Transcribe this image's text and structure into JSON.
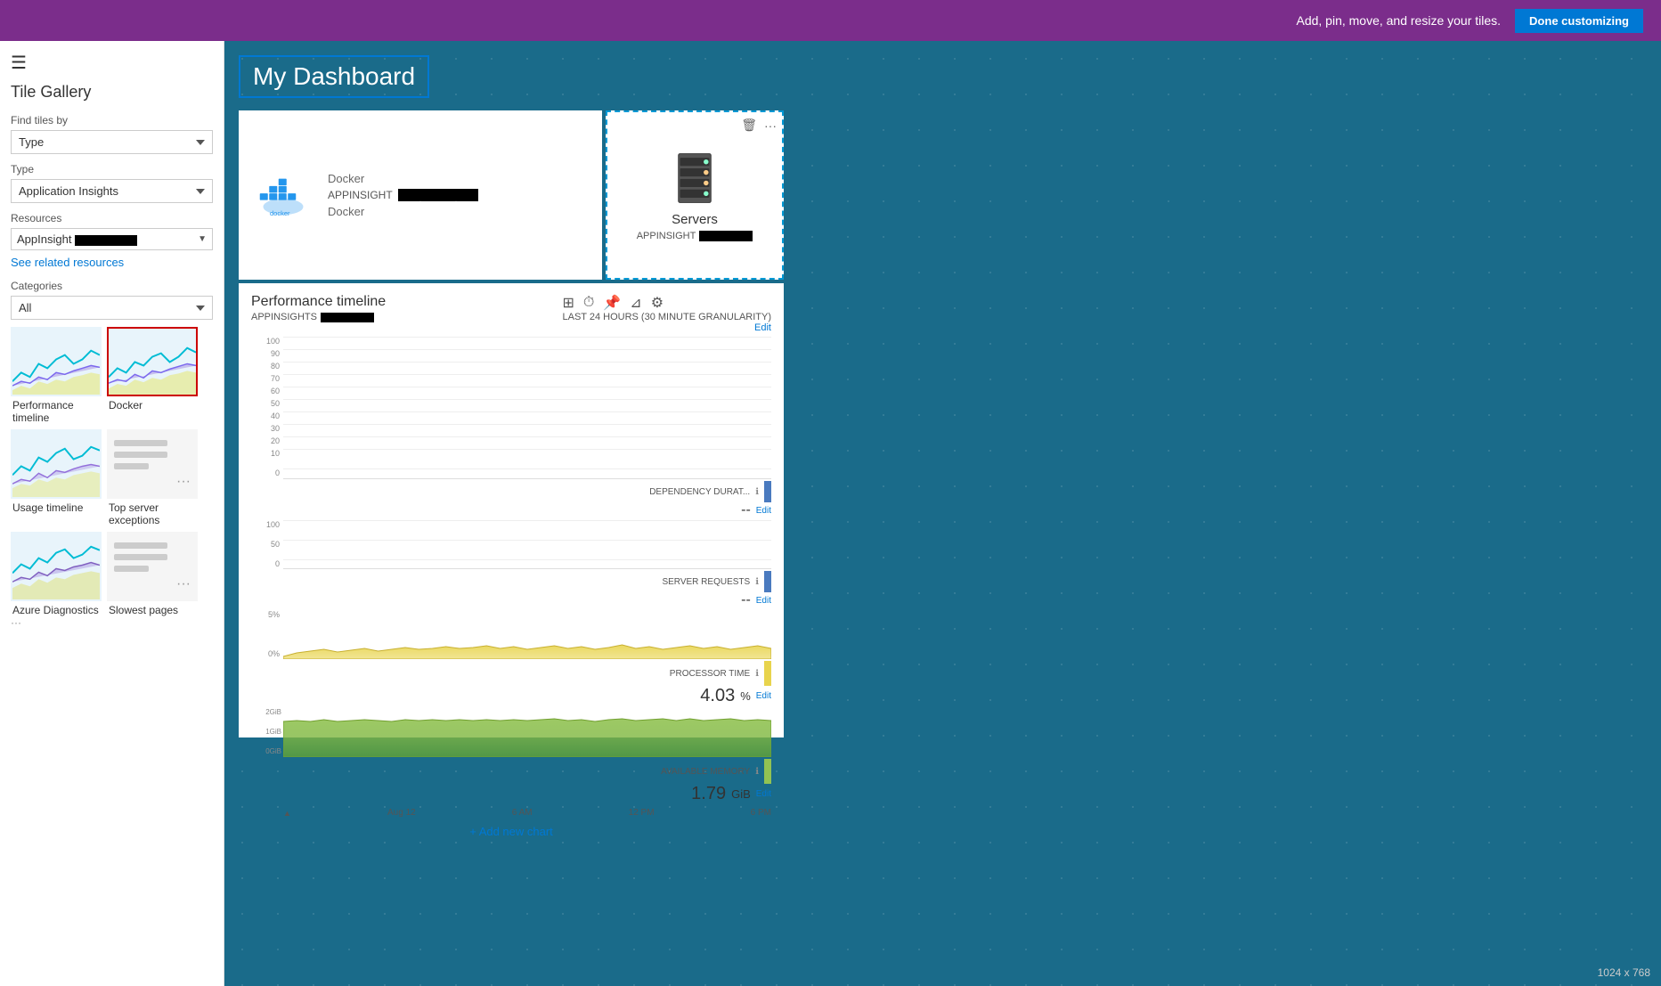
{
  "topBar": {
    "message": "Add, pin, move, and resize your tiles.",
    "doneBtn": "Done customizing"
  },
  "sidebar": {
    "title": "Tile Gallery",
    "hamburgerLabel": "☰",
    "findTilesBy": "Find tiles by",
    "findType": "Type",
    "typeLabel": "Type",
    "typeValue": "Application Insights",
    "resourcesLabel": "Resources",
    "resourceValue": "AppInsight",
    "seeRelated": "See related resources",
    "categoriesLabel": "Categories",
    "categoriesValue": "All",
    "tiles": [
      {
        "id": "perf-timeline",
        "label": "Performance timeline",
        "type": "chart",
        "selected": false
      },
      {
        "id": "docker",
        "label": "Docker",
        "type": "chart",
        "selected": true
      },
      {
        "id": "usage-timeline",
        "label": "Usage timeline",
        "type": "chart",
        "selected": false
      },
      {
        "id": "top-server-exc",
        "label": "Top server exceptions",
        "type": "text",
        "selected": false
      },
      {
        "id": "azure-diag",
        "label": "Azure Diagnostics",
        "type": "chart",
        "selected": false
      },
      {
        "id": "slowest-pages",
        "label": "Slowest pages",
        "type": "text",
        "selected": false
      }
    ]
  },
  "dashboard": {
    "title": "My Dashboard",
    "dockerTile": {
      "appType": "Docker",
      "appinsightLabel": "APPINSIGHT",
      "service": "Docker"
    },
    "serversTile": {
      "label": "Servers",
      "appinsightLabel": "APPINSIGHT"
    },
    "perfTile": {
      "title": "Performance timeline",
      "appinsightLabel": "APPINSIGHTS",
      "granularity": "LAST 24 HOURS (30 MINUTE GRANULARITY)",
      "editLabel": "Edit",
      "metrics": [
        {
          "name": "DEPENDENCY DURAT...",
          "value": "--",
          "unit": "",
          "color": "#4a7abf",
          "editLabel": "Edit"
        },
        {
          "name": "SERVER REQUESTS",
          "value": "--",
          "unit": "",
          "color": "#4a7abf",
          "editLabel": "Edit"
        },
        {
          "name": "PROCESSOR TIME",
          "value": "4.03",
          "unit": "%",
          "color": "#e8d44d",
          "editLabel": "Edit"
        },
        {
          "name": "AVAILABLE MEMORY",
          "value": "1.79",
          "unit": "GiB",
          "color": "#92c353",
          "editLabel": "Edit"
        }
      ],
      "yAxis1": [
        "100",
        "90",
        "80",
        "70",
        "60",
        "50",
        "40",
        "30",
        "20",
        "10",
        "0"
      ],
      "yAxis2": [
        "100",
        "50",
        "0"
      ],
      "yAxis3": [
        "5%",
        "0%"
      ],
      "yAxis4": [
        "2GiB",
        "1GiB",
        "0GiB"
      ],
      "timeLabels": [
        "Aug 12",
        "6 AM",
        "12 PM",
        "6 PM"
      ],
      "addChart": "+ Add new chart"
    }
  },
  "dimensionLabel": "1024 x 768"
}
